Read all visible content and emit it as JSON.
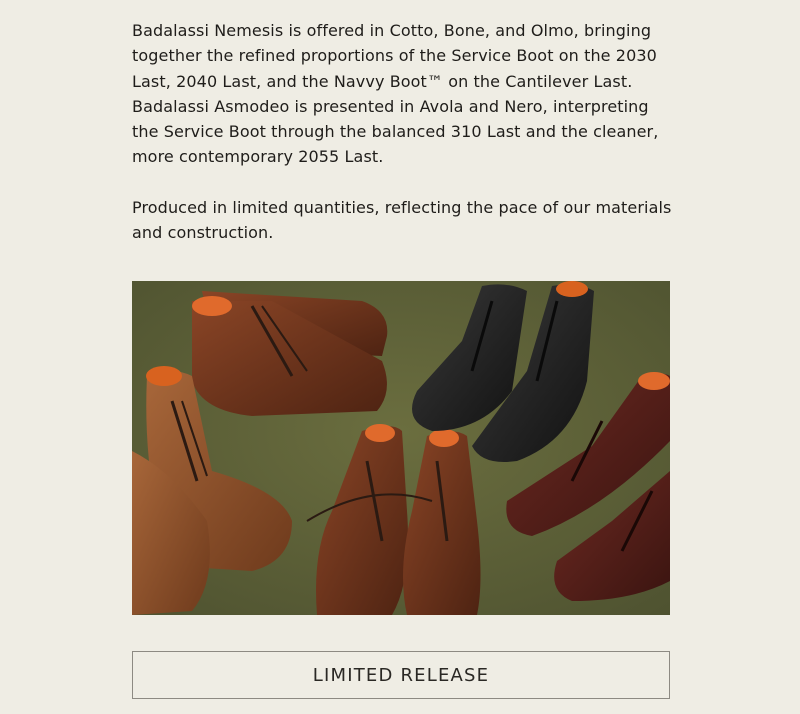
{
  "body": {
    "paragraph_1": "Badalassi Nemesis is offered in Cotto, Bone, and Olmo, bringing together the refined proportions of the Service Boot on the 2030 Last, 2040 Last, and the Navvy Boot™ on the Cantilever Last. Badalassi Asmodeo is presented in Avola and Nero, interpreting the Service Boot through the balanced 310 Last and the cleaner, more contemporary 2055 Last.",
    "paragraph_2": "Produced in limited quantities, reflecting the pace of our materials and construction."
  },
  "image": {
    "subject": "Leather service boots in tan, brown, black and oxblood arranged on an olive green surface"
  },
  "cta": {
    "label": "LIMITED RELEASE"
  },
  "colors": {
    "background": "#efede4",
    "text": "#1f1d1a",
    "button_border": "#8d8a82",
    "photo_backdrop": "#5f6338"
  }
}
